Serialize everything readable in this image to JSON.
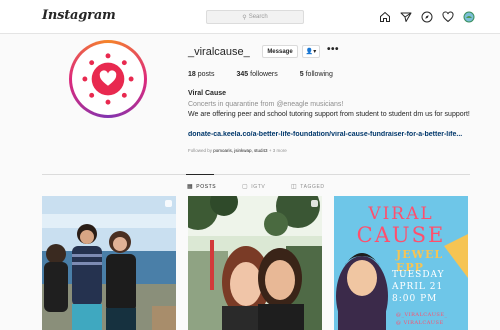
{
  "topbar": {
    "logo": "Instagram",
    "search_placeholder": "Search",
    "nav_icons": [
      "home-icon",
      "direct-icon",
      "explore-icon",
      "heart-icon",
      "profile-avatar"
    ]
  },
  "profile": {
    "username": "_viralcause_",
    "message_label": "Message",
    "follow_glyph": "👤▾",
    "more_glyph": "•••",
    "stats": [
      {
        "count": "18",
        "label": "posts"
      },
      {
        "count": "345",
        "label": "followers"
      },
      {
        "count": "5",
        "label": "following"
      }
    ],
    "full_name": "Viral Cause",
    "bio_line1": "Concerts in quarantine from @eneagle musicians!",
    "bio_line2": "We are offering peer and school tutoring support from student to student   dm us for support!",
    "link": "donate-ca.keela.co/a-better-life-foundation/viral-cause-fundraiser-for-a-better-life...",
    "followed_by_prefix": "Followed by",
    "followed_by_names": "pomoaris, jsinkwap, stud43",
    "followed_by_more": "+ 3 more"
  },
  "tabs": [
    {
      "label": "POSTS",
      "icon": "grid-icon",
      "active": true
    },
    {
      "label": "IGTV",
      "icon": "igtv-icon",
      "active": false
    },
    {
      "label": "TAGGED",
      "icon": "tagged-icon",
      "active": false
    }
  ],
  "poster": {
    "title_line1": "VIRAL",
    "title_line2": "CAUSE",
    "performer": "JEWEL EPP",
    "day": "TUESDAY",
    "date": "APRIL 21",
    "time": "8:00 PM",
    "footer1": "@_VIRALCAUSE_",
    "footer2": "@ VIRALCAUSE"
  },
  "colors": {
    "accent_pink": "#e8294f",
    "poster_bg": "#6ec6e8",
    "poster_text": "#ff4f6d",
    "poster_name": "#f6c453",
    "link_blue": "#00376b"
  }
}
